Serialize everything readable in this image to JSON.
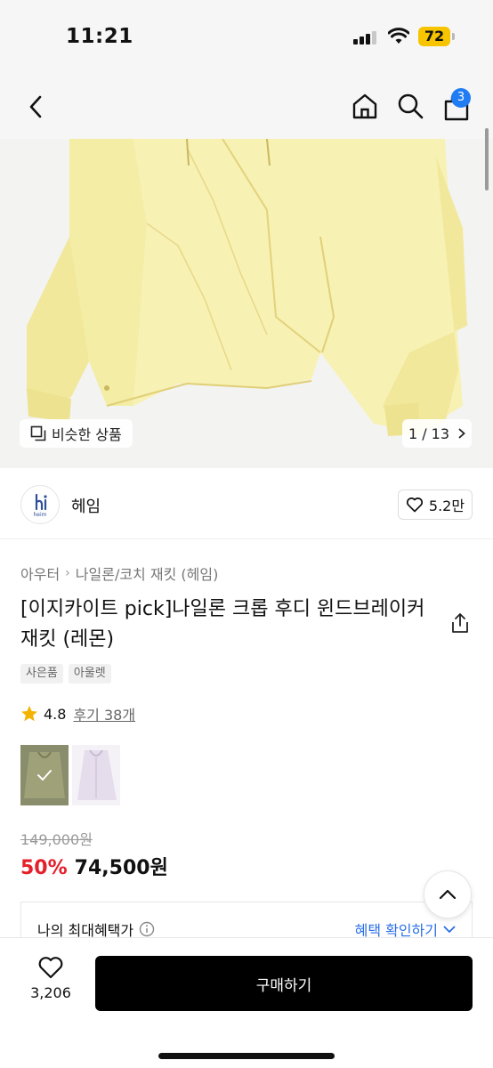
{
  "status": {
    "time": "11:21",
    "battery": "72"
  },
  "header": {
    "cart_count": "3"
  },
  "gallery": {
    "similar_label": "비슷한 상품",
    "page_counter": "1 / 13"
  },
  "brand": {
    "name": "헤임",
    "logo_text": "heim",
    "likes": "5.2만"
  },
  "breadcrumb": [
    "아우터",
    "나일론/코치 재킷 (헤임)"
  ],
  "product": {
    "title": "[이지카이트 pick]나일론 크롭 후디 윈드브레이커 재킷 (레몬)",
    "tags": [
      "사은품",
      "아울렛"
    ],
    "rating": "4.8",
    "review_link": "후기 38개",
    "original_price": "149,000원",
    "discount": "50%",
    "sale_price": "74,500원"
  },
  "benefit": {
    "label": "나의 최대혜택가",
    "link": "혜택 확인하기"
  },
  "bottom": {
    "wish_count": "3,206",
    "buy_label": "구매하기"
  },
  "colors": {
    "accent_blue": "#1f7cf2",
    "discount_red": "#e4202b",
    "buy_button": "#000000",
    "product_lemon": "#f8f1b4"
  }
}
